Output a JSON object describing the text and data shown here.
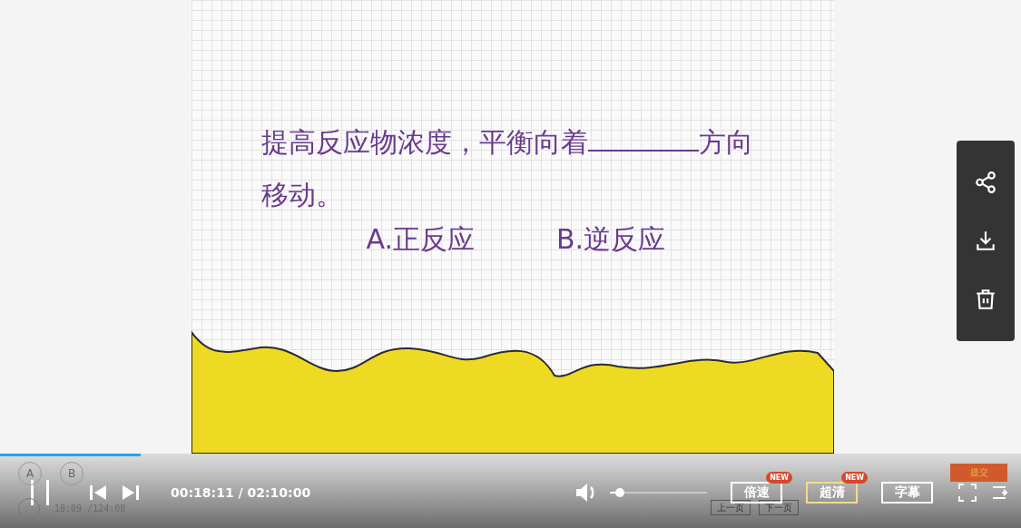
{
  "slide": {
    "question_start": "提高反应物浓度，平衡向着",
    "question_end": "方向移动。",
    "options": [
      "A.正反应",
      "B.逆反应"
    ]
  },
  "player": {
    "progress": {
      "level": 0.138
    },
    "time": "00:18:11 / 02:10:00",
    "volume": {
      "level": 0.1
    },
    "buttons": [
      {
        "label": "倍速",
        "badge": "NEW",
        "selected": false
      },
      {
        "label": "超清",
        "badge": "NEW",
        "selected": true
      },
      {
        "label": "字幕",
        "selected": false
      }
    ]
  },
  "overlay": {
    "markers": [
      "A",
      "B"
    ],
    "time": "18:09 /124:08",
    "submit": "提交",
    "pages": [
      "上一页",
      "下一页"
    ]
  }
}
